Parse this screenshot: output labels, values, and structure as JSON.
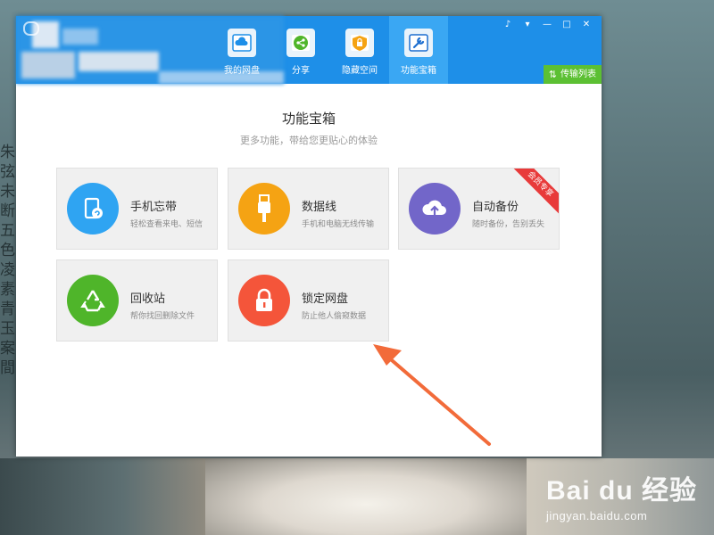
{
  "background": {
    "vertical_text": "朱弦未断五色凌素青玉案間"
  },
  "watermark": {
    "logo": "Bai du 经验",
    "url": "jingyan.baidu.com"
  },
  "titlebar": {
    "tabs": [
      {
        "label": "我的网盘",
        "icon": "cloud-drive-icon",
        "active": false
      },
      {
        "label": "分享",
        "icon": "share-icon",
        "active": false
      },
      {
        "label": "隐藏空间",
        "icon": "lock-folder-icon",
        "active": false
      },
      {
        "label": "功能宝箱",
        "icon": "toolbox-icon",
        "active": true
      }
    ],
    "window_controls": {
      "notify": "♪",
      "menu": "▾",
      "minimize": "—",
      "maximize": "□",
      "close": "✕"
    },
    "transfer_list_label": "传输列表"
  },
  "main": {
    "title": "功能宝箱",
    "subtitle": "更多功能，带给您更贴心的体验",
    "cards": [
      {
        "title": "手机忘带",
        "desc": "轻松查看来电、短信",
        "icon": "phone-icon",
        "color": "#2fa4f2",
        "ribbon": ""
      },
      {
        "title": "数据线",
        "desc": "手机和电脑无线传输",
        "icon": "usb-icon",
        "color": "#f5a313",
        "ribbon": ""
      },
      {
        "title": "自动备份",
        "desc": "随时备份，告别丢失",
        "icon": "cloud-upload-icon",
        "color": "#7266c9",
        "ribbon": "会员专享"
      },
      {
        "title": "回收站",
        "desc": "帮你找回删除文件",
        "icon": "recycle-icon",
        "color": "#4fb52a",
        "ribbon": ""
      },
      {
        "title": "锁定网盘",
        "desc": "防止他人偷窥数据",
        "icon": "lock-icon",
        "color": "#f4553a",
        "ribbon": ""
      }
    ]
  },
  "annotation": {
    "arrow_color": "#f26b3a"
  }
}
